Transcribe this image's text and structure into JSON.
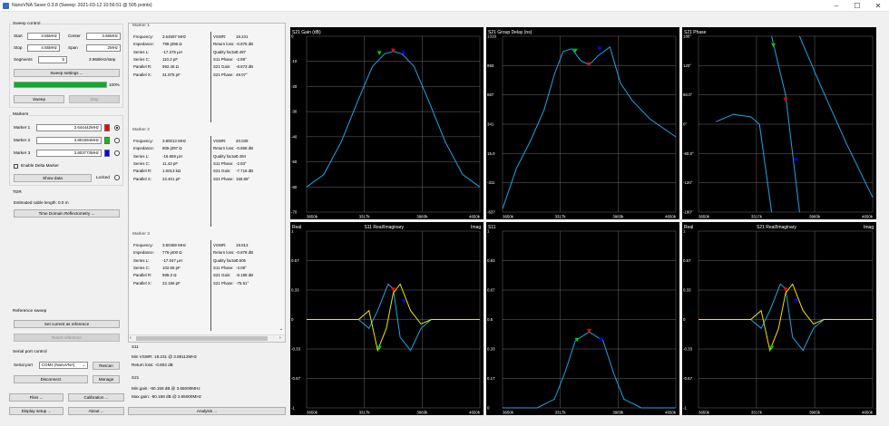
{
  "window": {
    "title": "NanoVNA Saver 0.3.8 (Sweep: 2021-03-12 10:56:51 @ 505 points)",
    "controls": {
      "minimize": "–",
      "maximize": "☐",
      "close": "✕"
    }
  },
  "sweep_control": {
    "title": "Sweep control",
    "start_label": "Start",
    "start_value": "3.65MHz",
    "center_label": "Center",
    "center_value": "3.65MHz",
    "stop_label": "Stop",
    "stop_value": "4.65MHz",
    "span_label": "Span",
    "span_value": "2MHz",
    "segments_label": "Segments",
    "segments_value": "5",
    "step_text": "3.968kHz/step",
    "settings_button": "Sweep settings ...",
    "progress_percent": 100,
    "progress_text": "100%",
    "sweep_button": "Sweep",
    "stop_button": "Stop"
  },
  "markers": {
    "title": "Markers",
    "items": [
      {
        "label": "Marker 1",
        "value": "3.644442MHz",
        "color": "#ff0000",
        "selected": true
      },
      {
        "label": "Marker 2",
        "value": "3.801594MHz",
        "color": "#00cc00",
        "selected": false
      },
      {
        "label": "Marker 3",
        "value": "3.803773MHz",
        "color": "#0000ff",
        "selected": false
      }
    ],
    "delta_label": "Enable Delta Marker",
    "show_data_button": "Show data",
    "locked_label": "Locked"
  },
  "tdr": {
    "title": "TDR",
    "cable_length": "Estimated cable length: 0.0 m",
    "button": "Time Domain Reflectometry ..."
  },
  "reference_sweep": {
    "title": "Reference sweep",
    "set_button": "Set current as reference",
    "reset_button": "Reset reference"
  },
  "serial_port": {
    "title": "Serial port control",
    "label": "Serial port",
    "port_value": "COM4 (NanoVNA)",
    "rescan_button": "Rescan",
    "disconnect_button": "Disconnect",
    "manage_button": "Manage"
  },
  "bottom_buttons": {
    "files": "Files ...",
    "calibration": "Calibration ...",
    "display_setup": "Display setup ...",
    "about": "About ...",
    "analysis": "Analysis ..."
  },
  "marker_info": [
    {
      "title": "Marker 1",
      "left": [
        [
          "Frequency:",
          "3.64597 MHz"
        ],
        [
          "Impedance:",
          "795-j396 Ω"
        ],
        [
          "Series L:",
          "-17.275 µH"
        ],
        [
          "Series C:",
          "110.2 pF"
        ],
        [
          "Parallel R:",
          "992.46 Ω"
        ],
        [
          "Parallel X:",
          "31.878 pF"
        ]
      ],
      "right": [
        [
          "VSWR:",
          "18.231"
        ],
        [
          "Return loss:",
          "-0.875 dB"
        ],
        [
          "Quality factor:",
          "0.497"
        ],
        [
          "S11 Phase:",
          "-2.89°"
        ],
        [
          "S21 Gain:",
          "-8.873 dB"
        ],
        [
          "S21 Phase:",
          "49.07°"
        ]
      ]
    },
    {
      "title": "Marker 2",
      "left": [
        [
          "Frequency:",
          "3.80013 MHz"
        ],
        [
          "Impedance:",
          "805-j397 Ω"
        ],
        [
          "Series L:",
          "-16.659 µH"
        ],
        [
          "Series C:",
          "11.43 pF"
        ],
        [
          "Parallel R:",
          "1.0013 kΩ"
        ],
        [
          "Parallel X:",
          "22.401 pF"
        ]
      ],
      "right": [
        [
          "VSWR:",
          "20.039"
        ],
        [
          "Return loss:",
          "-0.868 dB"
        ],
        [
          "Quality factor:",
          "0.494"
        ],
        [
          "S11 Phase:",
          "-2.83°"
        ],
        [
          "S21 Gain:",
          "-7.716 dB"
        ],
        [
          "S21 Phase:",
          "160.85°"
        ]
      ]
    },
    {
      "title": "Marker 3",
      "left": [
        [
          "Frequency:",
          "3.80469 MHz"
        ],
        [
          "Impedance:",
          "776-j400 Ω"
        ],
        [
          "Series L:",
          "-17.047 µH"
        ],
        [
          "Series C:",
          "102.65 pF"
        ],
        [
          "Parallel R:",
          "989.3 Ω"
        ],
        [
          "Parallel X:",
          "22.196 pF"
        ]
      ],
      "right": [
        [
          "VSWR:",
          "19.813"
        ],
        [
          "Return loss:",
          "-0.878 dB"
        ],
        [
          "Quality factor:",
          "0.505"
        ],
        [
          "S11 Phase:",
          "-3.08°"
        ],
        [
          "S21 Gain:",
          "-8.198 dB"
        ],
        [
          "S21 Phase:",
          "-75.51°"
        ]
      ]
    }
  ],
  "s11_summary": {
    "title": "S11",
    "min_vswr": "Min VSWR:   19.231 @ 3.89112MHz",
    "return_loss": "Return loss:   -0.804 dB"
  },
  "s21_summary": {
    "title": "S21",
    "min_gain": "Min gain:   -60.158 dB @ 3.65000MHz",
    "max_gain": "Max gain:   -60.158 dB @ 3.65000MHz"
  },
  "chart_data": [
    {
      "type": "line",
      "title": "S21 Gain (dB)",
      "x_ticks": [
        "3650k",
        "3317k",
        "3983k",
        "4650k"
      ],
      "y_ticks": [
        "0",
        "-10",
        "-20",
        "-30",
        "-40",
        "-50",
        "-60",
        "-70"
      ],
      "ylim": [
        -70,
        0
      ],
      "series": [
        {
          "x": [
            0,
            0.1,
            0.2,
            0.3,
            0.38,
            0.45,
            0.5,
            0.55,
            0.62,
            0.7,
            0.8,
            0.9,
            1
          ],
          "y": [
            -60,
            -55,
            -42,
            -25,
            -12,
            -7,
            -6,
            -7,
            -12,
            -25,
            -42,
            -55,
            -60
          ]
        }
      ],
      "markers": [
        {
          "color": "#00cc00",
          "x": 0.42,
          "y": -7
        },
        {
          "color": "#ff0000",
          "x": 0.5,
          "y": -6
        },
        {
          "color": "#0000ff",
          "x": 0.56,
          "y": -7
        }
      ],
      "line_color": "#1fa5e6",
      "grid": true
    },
    {
      "type": "line",
      "title": "S21 Group Delay (ns)",
      "x_ticks": [
        "3650k",
        "3317k",
        "3983k",
        "4650k"
      ],
      "y_ticks": [
        "1319",
        "993",
        "667",
        "341",
        "15.0",
        "-311",
        "-637"
      ],
      "ylim": [
        -637,
        1319
      ],
      "series": [
        {
          "x": [
            0,
            0.08,
            0.16,
            0.24,
            0.3,
            0.35,
            0.4,
            0.45,
            0.5,
            0.55,
            0.62,
            0.68,
            0.75,
            0.85,
            1
          ],
          "y": [
            -600,
            -150,
            150,
            500,
            900,
            1150,
            1180,
            1050,
            1000,
            1100,
            1200,
            800,
            600,
            400,
            200
          ]
        }
      ],
      "markers": [
        {
          "color": "#00cc00",
          "x": 0.42,
          "y": 1150
        },
        {
          "color": "#ff0000",
          "x": 0.5,
          "y": 1000
        },
        {
          "color": "#0000ff",
          "x": 0.56,
          "y": 1170
        }
      ],
      "line_color": "#1fa5e6",
      "grid": true
    },
    {
      "type": "line",
      "title": "S21 Phase",
      "x_ticks": [
        "3650k",
        "3317k",
        "3983k",
        "4650k"
      ],
      "y_ticks": [
        "180°",
        "120°",
        "60.0°",
        "0°",
        "-60.0°",
        "-120°",
        "-180°"
      ],
      "ylim": [
        -180,
        180
      ],
      "series": [
        {
          "x": [
            0.1,
            0.2,
            0.3,
            0.35,
            0.42
          ],
          "y": [
            5,
            20,
            15,
            0,
            -180
          ]
        },
        {
          "x": [
            0.42,
            0.5,
            0.58
          ],
          "y": [
            180,
            60,
            -180
          ]
        },
        {
          "x": [
            0.58,
            0.7,
            0.85,
            1
          ],
          "y": [
            180,
            80,
            -40,
            -150
          ]
        }
      ],
      "markers": [
        {
          "color": "#00cc00",
          "x": 0.43,
          "y": 160
        },
        {
          "color": "#ff0000",
          "x": 0.5,
          "y": 49
        },
        {
          "color": "#0000ff",
          "x": 0.56,
          "y": -75
        }
      ],
      "line_color": "#1fa5e6",
      "grid": true
    },
    {
      "type": "line",
      "title": "S11 Real/Imaginary",
      "left_label": "Real",
      "right_label": "Imag",
      "x_ticks": [
        "3650k",
        "3317k",
        "3983k",
        "4650k"
      ],
      "y_ticks": [
        "1",
        "0.67",
        "0.33",
        "0",
        "-0.33",
        "-0.67",
        "-1"
      ],
      "ylim": [
        -1,
        1
      ],
      "series": [
        {
          "name": "Real",
          "x": [
            0,
            0.3,
            0.36,
            0.41,
            0.47,
            0.5,
            0.54,
            0.6,
            0.66,
            0.72,
            1
          ],
          "y": [
            0,
            0,
            -0.1,
            0.1,
            0.4,
            0.35,
            -0.2,
            -0.35,
            -0.1,
            0,
            0
          ]
        },
        {
          "name": "Imag",
          "x": [
            0,
            0.3,
            0.36,
            0.41,
            0.46,
            0.5,
            0.54,
            0.6,
            0.66,
            0.72,
            1
          ],
          "y": [
            0,
            0,
            0.1,
            -0.35,
            -0.1,
            0.3,
            0.4,
            0.1,
            -0.05,
            0,
            0
          ]
        }
      ],
      "line_colors": [
        "#1fa5e6",
        "#f2e600"
      ],
      "markers": [
        {
          "color": "#00cc00",
          "x": 0.42,
          "y": -0.33
        },
        {
          "color": "#ff0000",
          "x": 0.5,
          "y": 0.33
        },
        {
          "color": "#0000ff",
          "x": 0.56,
          "y": 0.2
        }
      ],
      "grid": true
    },
    {
      "type": "line",
      "title": "S11",
      "x_ticks": [
        "3650k",
        "3317k",
        "3983k",
        "4650k"
      ],
      "y_ticks": [
        "1",
        "0.83",
        "0.67",
        "0.5",
        "0.33",
        "0.17",
        "0"
      ],
      "ylim": [
        0,
        1
      ],
      "series": [
        {
          "x": [
            0,
            0.2,
            0.3,
            0.36,
            0.42,
            0.5,
            0.58,
            0.64,
            0.7,
            0.8,
            1
          ],
          "y": [
            0,
            0,
            0.05,
            0.2,
            0.38,
            0.43,
            0.38,
            0.2,
            0.05,
            0,
            0
          ]
        }
      ],
      "markers": [
        {
          "color": "#00cc00",
          "x": 0.43,
          "y": 0.38
        },
        {
          "color": "#ff0000",
          "x": 0.5,
          "y": 0.43
        },
        {
          "color": "#0000ff",
          "x": 0.57,
          "y": 0.38
        }
      ],
      "line_color": "#1fa5e6",
      "grid": true
    },
    {
      "type": "line",
      "title": "S21 Real/Imaginary",
      "left_label": "Real",
      "right_label": "Imag",
      "x_ticks": [
        "3650k",
        "3317k",
        "3983k",
        "4650k"
      ],
      "y_ticks": [
        "1",
        "0.67",
        "0.33",
        "0",
        "-0.33",
        "-0.67",
        "-1"
      ],
      "ylim": [
        -1,
        1
      ],
      "series": [
        {
          "name": "Real",
          "x": [
            0,
            0.3,
            0.36,
            0.41,
            0.47,
            0.5,
            0.54,
            0.6,
            0.66,
            0.72,
            1
          ],
          "y": [
            0,
            0,
            -0.1,
            0.1,
            0.4,
            0.35,
            -0.2,
            -0.35,
            -0.1,
            0,
            0
          ]
        },
        {
          "name": "Imag",
          "x": [
            0,
            0.3,
            0.36,
            0.41,
            0.46,
            0.5,
            0.54,
            0.6,
            0.66,
            0.72,
            1
          ],
          "y": [
            0,
            0,
            0.1,
            -0.35,
            -0.1,
            0.3,
            0.4,
            0.1,
            -0.05,
            0,
            0
          ]
        }
      ],
      "line_colors": [
        "#1fa5e6",
        "#f2e600"
      ],
      "markers": [
        {
          "color": "#00cc00",
          "x": 0.42,
          "y": -0.33
        },
        {
          "color": "#ff0000",
          "x": 0.5,
          "y": 0.33
        },
        {
          "color": "#0000ff",
          "x": 0.56,
          "y": 0.2
        }
      ],
      "grid": true
    }
  ]
}
